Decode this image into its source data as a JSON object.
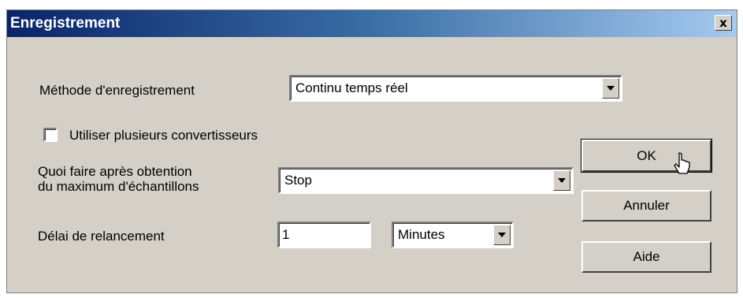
{
  "window": {
    "title": "Enregistrement",
    "close_glyph": "x"
  },
  "method": {
    "label": "Méthode d'enregistrement",
    "value": "Continu temps réel"
  },
  "multi_converter": {
    "label": "Utiliser plusieurs convertisseurs",
    "checked": false
  },
  "after_max": {
    "label_line1": "Quoi faire après obtention",
    "label_line2": "du maximum d'échantillons",
    "value": "Stop"
  },
  "restart_delay": {
    "label": "Délai de relancement",
    "value": "1",
    "unit": "Minutes"
  },
  "buttons": {
    "ok": "OK",
    "cancel": "Annuler",
    "help": "Aide"
  },
  "icons": {
    "close": "close-icon",
    "dropdown": "chevron-down-icon",
    "cursor": "pointer-cursor-icon"
  },
  "colors": {
    "titlebar_start": "#0a246a",
    "titlebar_end": "#a6caf0",
    "face": "#d4d0c8"
  }
}
